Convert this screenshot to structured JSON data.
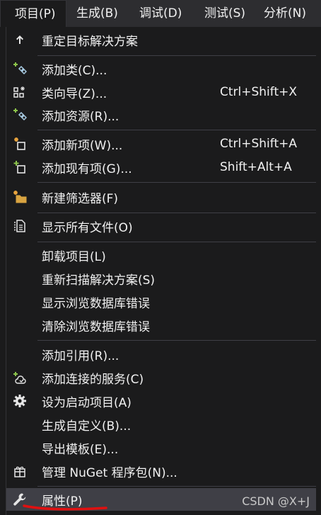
{
  "menubar": {
    "items": [
      {
        "label": "项目(P)"
      },
      {
        "label": "生成(B)"
      },
      {
        "label": "调试(D)"
      },
      {
        "label": "测试(S)"
      },
      {
        "label": "分析(N)"
      }
    ]
  },
  "menu": {
    "items": [
      {
        "label": "重定目标解决方案",
        "shortcut": "",
        "icon": "arrow-up-icon"
      },
      {
        "label": "添加类(C)...",
        "shortcut": "",
        "icon": "add-class-icon"
      },
      {
        "label": "类向导(Z)...",
        "shortcut": "Ctrl+Shift+X",
        "icon": "class-wizard-icon"
      },
      {
        "label": "添加资源(R)...",
        "shortcut": "",
        "icon": "add-resource-icon"
      },
      {
        "label": "添加新项(W)...",
        "shortcut": "Ctrl+Shift+A",
        "icon": "add-new-item-icon"
      },
      {
        "label": "添加现有项(G)...",
        "shortcut": "Shift+Alt+A",
        "icon": "add-existing-item-icon"
      },
      {
        "label": "新建筛选器(F)",
        "shortcut": "",
        "icon": "new-filter-folder-icon"
      },
      {
        "label": "显示所有文件(O)",
        "shortcut": "",
        "icon": "show-all-files-icon"
      },
      {
        "label": "卸载项目(L)",
        "shortcut": "",
        "icon": ""
      },
      {
        "label": "重新扫描解决方案(S)",
        "shortcut": "",
        "icon": ""
      },
      {
        "label": "显示浏览数据库错误",
        "shortcut": "",
        "icon": ""
      },
      {
        "label": "清除浏览数据库错误",
        "shortcut": "",
        "icon": ""
      },
      {
        "label": "添加引用(R)...",
        "shortcut": "",
        "icon": ""
      },
      {
        "label": "添加连接的服务(C)",
        "shortcut": "",
        "icon": "connected-service-icon"
      },
      {
        "label": "设为启动项目(A)",
        "shortcut": "",
        "icon": "gear-icon"
      },
      {
        "label": "生成自定义(B)...",
        "shortcut": "",
        "icon": ""
      },
      {
        "label": "导出模板(E)...",
        "shortcut": "",
        "icon": ""
      },
      {
        "label": "管理 NuGet 程序包(N)...",
        "shortcut": "",
        "icon": "nuget-package-icon"
      },
      {
        "label": "属性(P)",
        "shortcut": "",
        "icon": "wrench-icon"
      }
    ]
  },
  "watermark": "CSDN @X+J",
  "colors": {
    "menu_background": "#1b1b1c",
    "menubar_background": "#2d2d30",
    "selected_background": "#3f3f46",
    "text": "#f1f1f1",
    "icon_green": "#8bc34a",
    "icon_accent": "#e8a33d",
    "underline_red": "#e01010"
  }
}
